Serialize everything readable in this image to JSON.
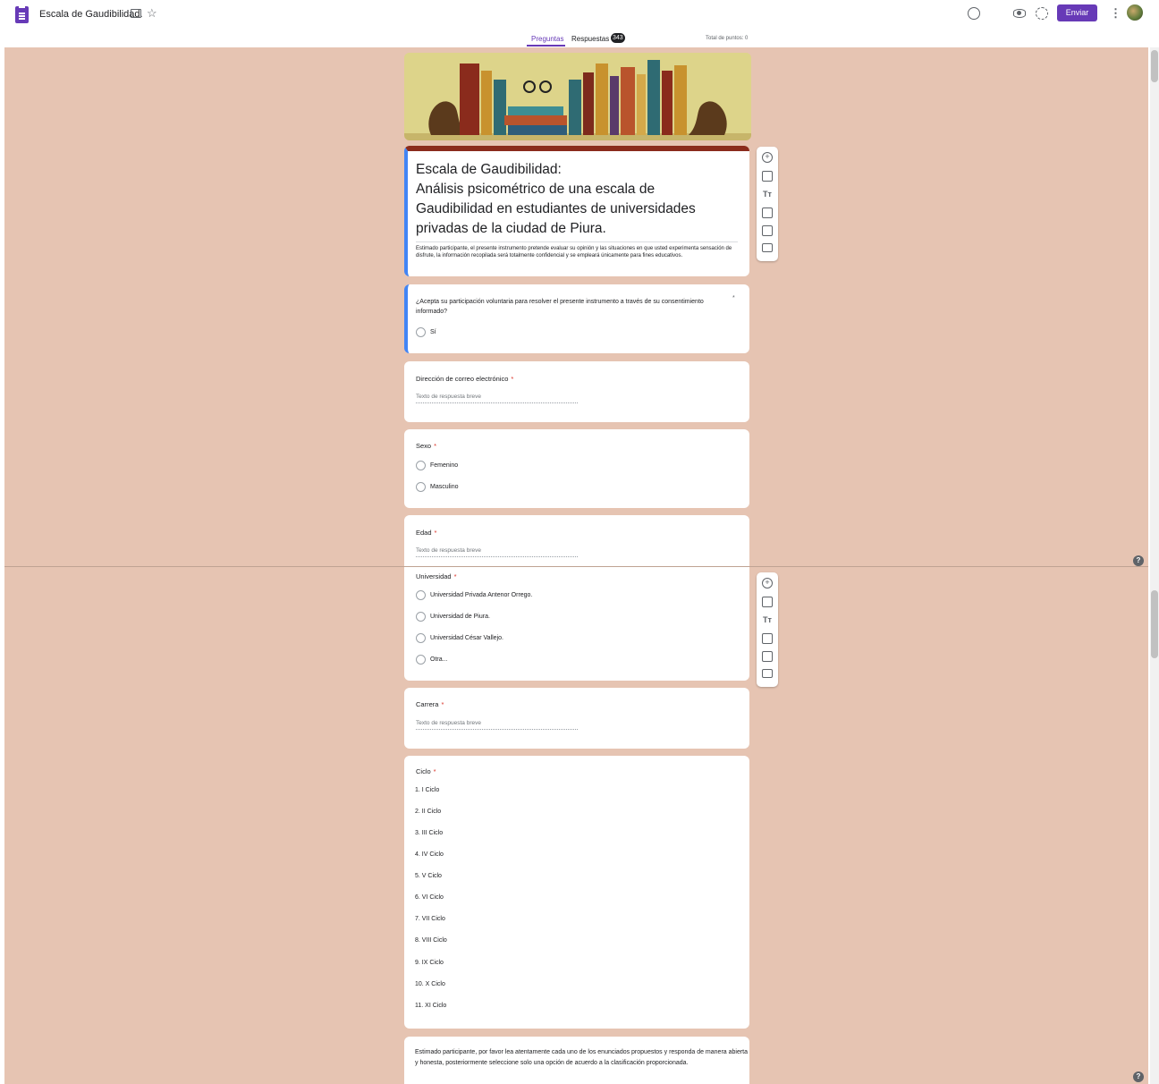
{
  "header": {
    "doc_title": "Escala de Gaudibilidad.",
    "send_label": "Enviar",
    "icons": [
      "forms-app-icon",
      "folder-icon",
      "star-icon",
      "palette-icon",
      "eye-icon",
      "gear-icon",
      "more-icon"
    ]
  },
  "tabs": {
    "questions": "Preguntas",
    "responses": "Respuestas",
    "responses_count": "343",
    "total_points": "Total de puntos: 0"
  },
  "colors": {
    "accent": "#673ab7",
    "background": "#e6c4b2",
    "active_border": "#4285f4",
    "required": "#d93025"
  },
  "form": {
    "title_lines": [
      "Escala de Gaudibilidad:",
      "Análisis psicométrico de una escala de",
      "Gaudibilidad en estudiantes de universidades",
      "privadas de la ciudad de Piura."
    ],
    "description": "Estimado participante, el presente instrumento pretende evaluar su opinión y las situaciones en que usted experimenta sensación de disfrute, la información recopilada será totalmente confidencial y se empleará únicamente para fines educativos."
  },
  "questions": {
    "consent": {
      "label": "¿Acepta su participación voluntaria para resolver el presente instrumento a través de su consentimiento informado?",
      "required": "*",
      "options": [
        "Sí"
      ]
    },
    "email": {
      "label": "Dirección de correo electrónico",
      "required": "*",
      "placeholder": "Texto de respuesta breve"
    },
    "sex": {
      "label": "Sexo",
      "required": "*",
      "options": [
        "Femenino",
        "Masculino"
      ]
    },
    "age": {
      "label": "Edad",
      "required": "*",
      "placeholder": "Texto de respuesta breve"
    },
    "university": {
      "label": "Universidad",
      "required": "*",
      "options": [
        "Universidad Privada Antenor Orrego.",
        "Universidad de Piura.",
        "Universidad César Vallejo.",
        "Otra..."
      ]
    },
    "career": {
      "label": "Carrera",
      "required": "*",
      "placeholder": "Texto de respuesta breve"
    },
    "cycle": {
      "label": "Ciclo",
      "required": "*",
      "options": [
        "1.  I Ciclo",
        "2.  II Ciclo",
        "3.  III Ciclo",
        "4.  IV Ciclo",
        "5.  V Ciclo",
        "6.  VI Ciclo",
        "7.  VII Ciclo",
        "8.  VIII Ciclo",
        "9.  IX Ciclo",
        "10.  X Ciclo",
        "11.  XI Ciclo"
      ]
    }
  },
  "instructions": "Estimado participante, por favor lea atentamente cada uno de los enunciados propuestos y responda de manera abierta y honesta, posteriormente seleccione solo una opción de acuerdo a la clasificación proporcionada.",
  "toolbar": {
    "icons": [
      "add-question-icon",
      "import-questions-icon",
      "add-title-icon",
      "add-image-icon",
      "add-video-icon",
      "add-section-icon"
    ],
    "title_glyph": "Tт"
  },
  "help_glyph": "?"
}
